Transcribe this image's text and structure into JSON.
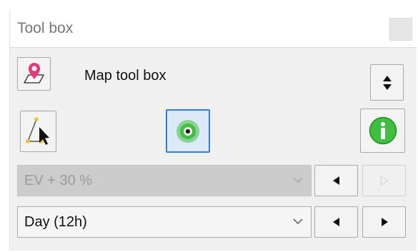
{
  "window": {
    "title": "Tool box"
  },
  "toolbox": {
    "label": "Map tool box"
  },
  "row3": {
    "select_value": "EV + 30 %",
    "disabled": true
  },
  "row4": {
    "select_value": "Day (12h)"
  },
  "colors": {
    "pin": "#e5387a",
    "green": "#3fbf3f",
    "selected_border": "#2f7fd6",
    "selected_bg": "#dbe9f8"
  },
  "icons": {
    "map_pin": "map-pin-icon",
    "sort": "sort-updown-icon",
    "select_tool": "polygon-select-cursor-icon",
    "target": "target-icon",
    "info": "info-icon"
  }
}
